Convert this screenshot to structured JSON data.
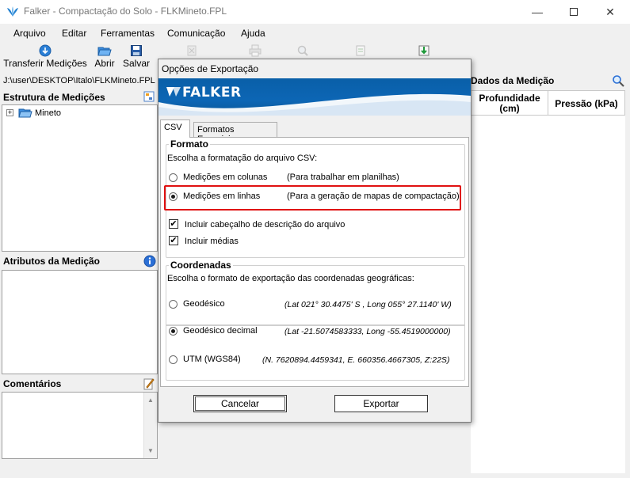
{
  "window": {
    "title": "Falker - Compactação do Solo - FLKMineto.FPL"
  },
  "menu": [
    "Arquivo",
    "Editar",
    "Ferramentas",
    "Comunicação",
    "Ajuda"
  ],
  "toolbar": {
    "transferir": "Transferir Medições",
    "abrir": "Abrir",
    "salvar": "Salvar"
  },
  "path": "J:\\user\\DESKTOP\\Italo\\FLKMineto.FPL",
  "left": {
    "estrutura_title": "Estrutura de Medições",
    "tree_item": "Mineto",
    "atributos_title": "Atributos da Medição",
    "comentarios_title": "Comentários"
  },
  "right": {
    "title": "Dados da Medição",
    "col_profundidade": "Profundidade (cm)",
    "col_pressao": "Pressão (kPa)"
  },
  "dialog": {
    "title": "Opções de Exportação",
    "brand": "FALKER",
    "tabs": [
      "CSV",
      "Formatos Especiais"
    ],
    "formato": {
      "title": "Formato",
      "instruction": "Escolha a formatação do arquivo CSV:",
      "options": [
        {
          "label": "Medições em colunas",
          "hint": "(Para trabalhar em planilhas)",
          "selected": false
        },
        {
          "label": "Medições em linhas",
          "hint": "(Para a geração de mapas de compactação)",
          "selected": true
        }
      ],
      "checks": [
        {
          "label": "Incluir cabeçalho de descrição do arquivo",
          "checked": true
        },
        {
          "label": "Incluir médias",
          "checked": true
        }
      ]
    },
    "coordenadas": {
      "title": "Coordenadas",
      "instruction": "Escolha o formato de exportação das coordenadas geográficas:",
      "options": [
        {
          "label": "Geodésico",
          "example": "(Lat 021° 30.4475' S , Long 055° 27.1140' W)",
          "selected": false
        },
        {
          "label": "Geodésico decimal",
          "example": "(Lat -21.5074583333, Long -55.4519000000)",
          "selected": true
        },
        {
          "label": "UTM (WGS84)",
          "example": "(N. 7620894.4459341, E. 660356.4667305, Z:22S)",
          "selected": false
        }
      ]
    },
    "buttons": {
      "cancel": "Cancelar",
      "export": "Exportar"
    }
  },
  "colors": {
    "highlight": "#e01010",
    "banner": "#0c66b5"
  }
}
